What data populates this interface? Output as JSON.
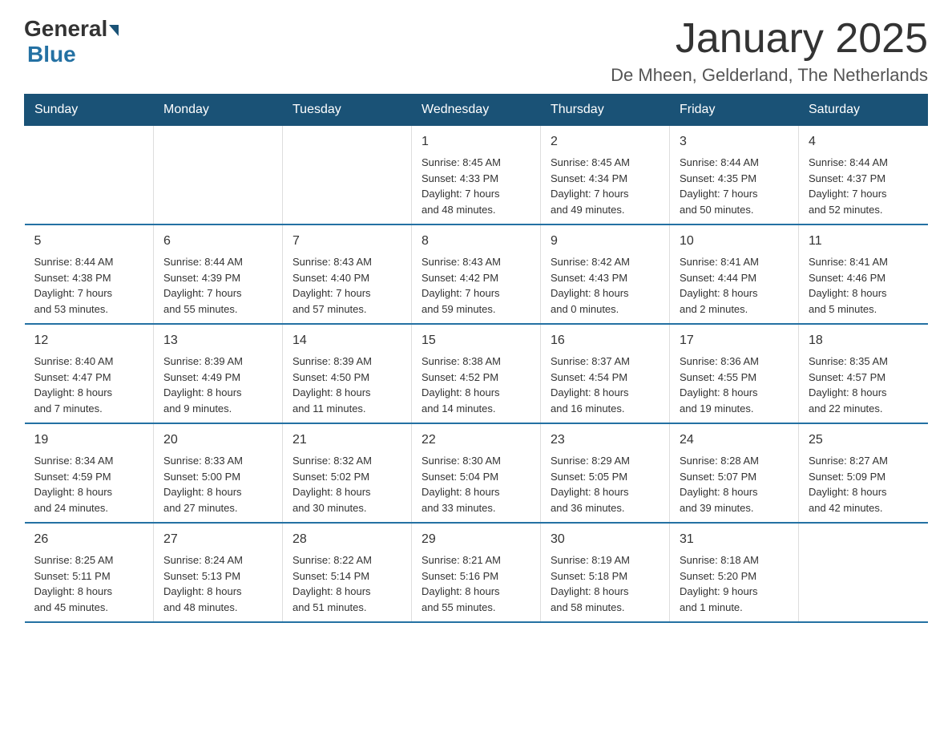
{
  "logo": {
    "general": "General",
    "blue": "Blue"
  },
  "title": "January 2025",
  "subtitle": "De Mheen, Gelderland, The Netherlands",
  "weekdays": [
    "Sunday",
    "Monday",
    "Tuesday",
    "Wednesday",
    "Thursday",
    "Friday",
    "Saturday"
  ],
  "weeks": [
    [
      {
        "day": "",
        "info": ""
      },
      {
        "day": "",
        "info": ""
      },
      {
        "day": "",
        "info": ""
      },
      {
        "day": "1",
        "info": "Sunrise: 8:45 AM\nSunset: 4:33 PM\nDaylight: 7 hours\nand 48 minutes."
      },
      {
        "day": "2",
        "info": "Sunrise: 8:45 AM\nSunset: 4:34 PM\nDaylight: 7 hours\nand 49 minutes."
      },
      {
        "day": "3",
        "info": "Sunrise: 8:44 AM\nSunset: 4:35 PM\nDaylight: 7 hours\nand 50 minutes."
      },
      {
        "day": "4",
        "info": "Sunrise: 8:44 AM\nSunset: 4:37 PM\nDaylight: 7 hours\nand 52 minutes."
      }
    ],
    [
      {
        "day": "5",
        "info": "Sunrise: 8:44 AM\nSunset: 4:38 PM\nDaylight: 7 hours\nand 53 minutes."
      },
      {
        "day": "6",
        "info": "Sunrise: 8:44 AM\nSunset: 4:39 PM\nDaylight: 7 hours\nand 55 minutes."
      },
      {
        "day": "7",
        "info": "Sunrise: 8:43 AM\nSunset: 4:40 PM\nDaylight: 7 hours\nand 57 minutes."
      },
      {
        "day": "8",
        "info": "Sunrise: 8:43 AM\nSunset: 4:42 PM\nDaylight: 7 hours\nand 59 minutes."
      },
      {
        "day": "9",
        "info": "Sunrise: 8:42 AM\nSunset: 4:43 PM\nDaylight: 8 hours\nand 0 minutes."
      },
      {
        "day": "10",
        "info": "Sunrise: 8:41 AM\nSunset: 4:44 PM\nDaylight: 8 hours\nand 2 minutes."
      },
      {
        "day": "11",
        "info": "Sunrise: 8:41 AM\nSunset: 4:46 PM\nDaylight: 8 hours\nand 5 minutes."
      }
    ],
    [
      {
        "day": "12",
        "info": "Sunrise: 8:40 AM\nSunset: 4:47 PM\nDaylight: 8 hours\nand 7 minutes."
      },
      {
        "day": "13",
        "info": "Sunrise: 8:39 AM\nSunset: 4:49 PM\nDaylight: 8 hours\nand 9 minutes."
      },
      {
        "day": "14",
        "info": "Sunrise: 8:39 AM\nSunset: 4:50 PM\nDaylight: 8 hours\nand 11 minutes."
      },
      {
        "day": "15",
        "info": "Sunrise: 8:38 AM\nSunset: 4:52 PM\nDaylight: 8 hours\nand 14 minutes."
      },
      {
        "day": "16",
        "info": "Sunrise: 8:37 AM\nSunset: 4:54 PM\nDaylight: 8 hours\nand 16 minutes."
      },
      {
        "day": "17",
        "info": "Sunrise: 8:36 AM\nSunset: 4:55 PM\nDaylight: 8 hours\nand 19 minutes."
      },
      {
        "day": "18",
        "info": "Sunrise: 8:35 AM\nSunset: 4:57 PM\nDaylight: 8 hours\nand 22 minutes."
      }
    ],
    [
      {
        "day": "19",
        "info": "Sunrise: 8:34 AM\nSunset: 4:59 PM\nDaylight: 8 hours\nand 24 minutes."
      },
      {
        "day": "20",
        "info": "Sunrise: 8:33 AM\nSunset: 5:00 PM\nDaylight: 8 hours\nand 27 minutes."
      },
      {
        "day": "21",
        "info": "Sunrise: 8:32 AM\nSunset: 5:02 PM\nDaylight: 8 hours\nand 30 minutes."
      },
      {
        "day": "22",
        "info": "Sunrise: 8:30 AM\nSunset: 5:04 PM\nDaylight: 8 hours\nand 33 minutes."
      },
      {
        "day": "23",
        "info": "Sunrise: 8:29 AM\nSunset: 5:05 PM\nDaylight: 8 hours\nand 36 minutes."
      },
      {
        "day": "24",
        "info": "Sunrise: 8:28 AM\nSunset: 5:07 PM\nDaylight: 8 hours\nand 39 minutes."
      },
      {
        "day": "25",
        "info": "Sunrise: 8:27 AM\nSunset: 5:09 PM\nDaylight: 8 hours\nand 42 minutes."
      }
    ],
    [
      {
        "day": "26",
        "info": "Sunrise: 8:25 AM\nSunset: 5:11 PM\nDaylight: 8 hours\nand 45 minutes."
      },
      {
        "day": "27",
        "info": "Sunrise: 8:24 AM\nSunset: 5:13 PM\nDaylight: 8 hours\nand 48 minutes."
      },
      {
        "day": "28",
        "info": "Sunrise: 8:22 AM\nSunset: 5:14 PM\nDaylight: 8 hours\nand 51 minutes."
      },
      {
        "day": "29",
        "info": "Sunrise: 8:21 AM\nSunset: 5:16 PM\nDaylight: 8 hours\nand 55 minutes."
      },
      {
        "day": "30",
        "info": "Sunrise: 8:19 AM\nSunset: 5:18 PM\nDaylight: 8 hours\nand 58 minutes."
      },
      {
        "day": "31",
        "info": "Sunrise: 8:18 AM\nSunset: 5:20 PM\nDaylight: 9 hours\nand 1 minute."
      },
      {
        "day": "",
        "info": ""
      }
    ]
  ]
}
